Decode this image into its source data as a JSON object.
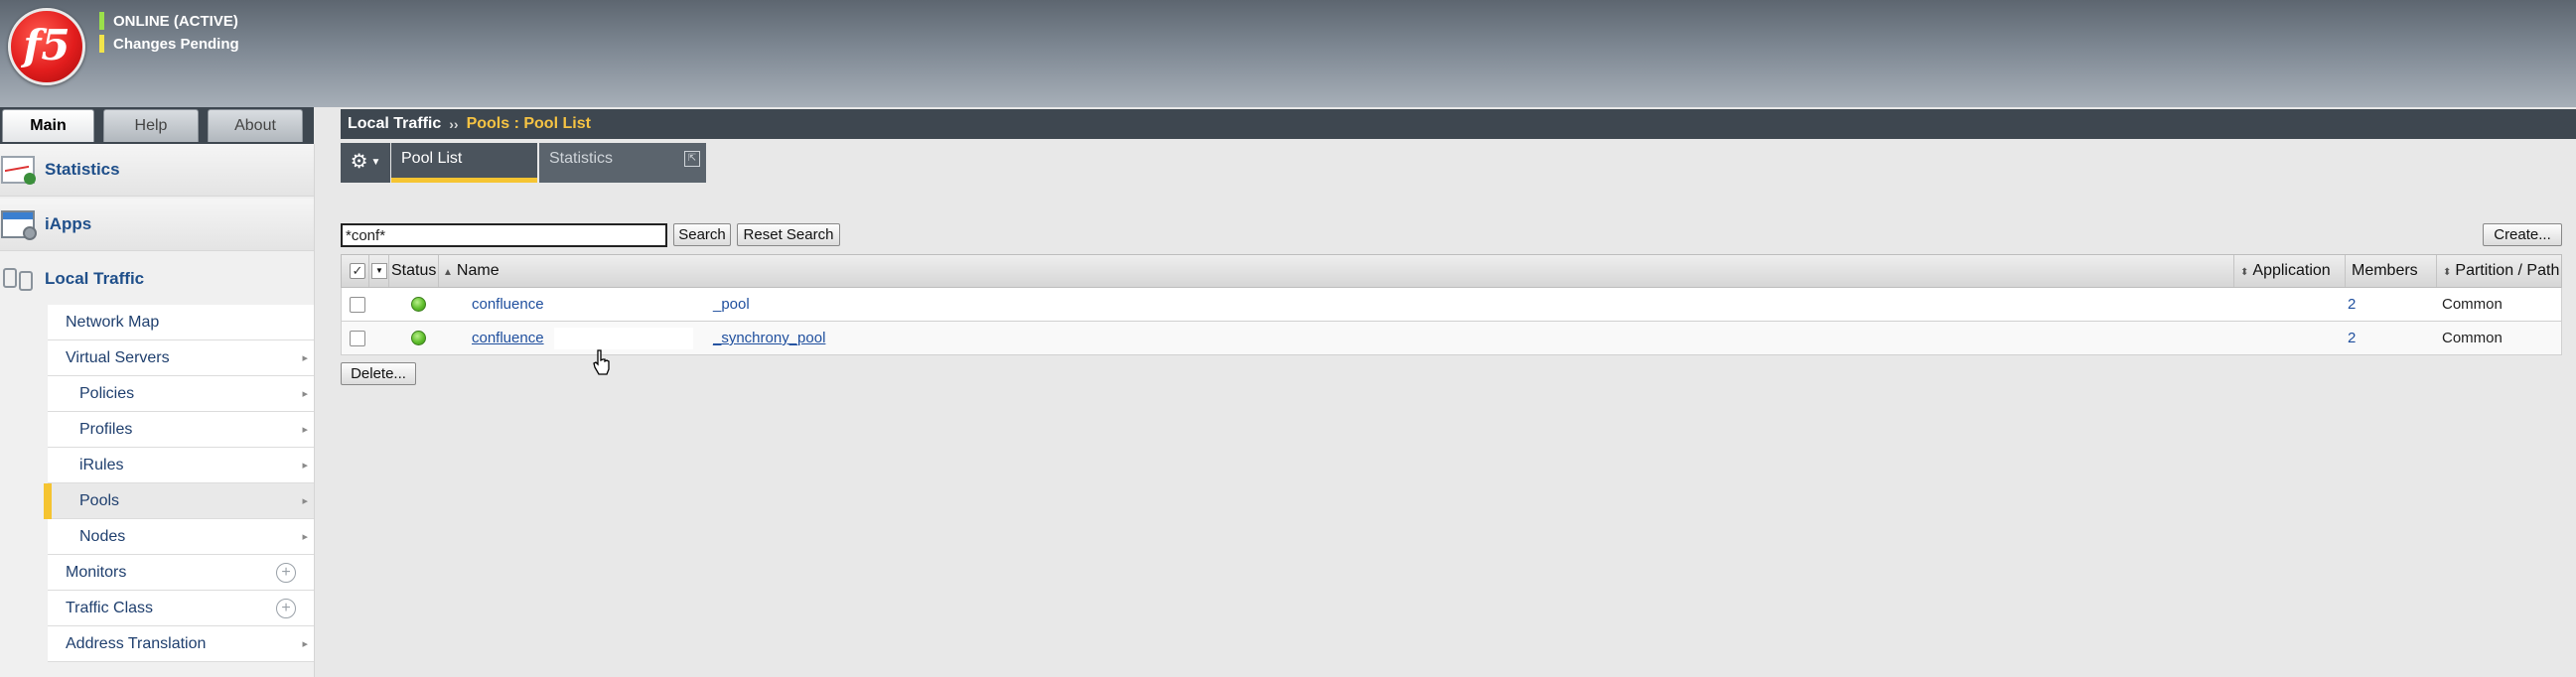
{
  "header": {
    "logo_text": "f5",
    "status_online": "ONLINE (ACTIVE)",
    "status_pending": "Changes Pending"
  },
  "left_tabs": [
    "Main",
    "Help",
    "About"
  ],
  "sidebar": {
    "sections": [
      {
        "label": "Statistics",
        "icon": "statistics-icon"
      },
      {
        "label": "iApps",
        "icon": "iapps-icon"
      },
      {
        "label": "Local Traffic",
        "icon": "local-traffic-icon"
      }
    ],
    "subitems": [
      {
        "label": "Network Map",
        "arrow": "",
        "plus": false
      },
      {
        "label": "Virtual Servers",
        "arrow": "▸",
        "plus": false
      },
      {
        "label": "Policies",
        "arrow": "▸",
        "plus": false
      },
      {
        "label": "Profiles",
        "arrow": "▸",
        "plus": false
      },
      {
        "label": "iRules",
        "arrow": "▸",
        "plus": false
      },
      {
        "label": "Pools",
        "arrow": "▸",
        "plus": false
      },
      {
        "label": "Nodes",
        "arrow": "▸",
        "plus": false
      },
      {
        "label": "Monitors",
        "arrow": "",
        "plus": true
      },
      {
        "label": "Traffic Class",
        "arrow": "",
        "plus": true
      },
      {
        "label": "Address Translation",
        "arrow": "▸",
        "plus": false
      }
    ],
    "plus_symbol": "+"
  },
  "breadcrumb": {
    "root": "Local Traffic",
    "separator": "››",
    "current": "Pools : Pool List"
  },
  "tabs": {
    "gear_symbol": "⚙",
    "dropdown_symbol": "▼",
    "pool_list": "Pool List",
    "statistics": "Statistics",
    "external_symbol": "⇱"
  },
  "search": {
    "value": "*conf*",
    "search_label": "Search",
    "reset_label": "Reset Search",
    "create_label": "Create..."
  },
  "table": {
    "columns": {
      "status": "Status",
      "name": "Name",
      "application": "Application",
      "members": "Members",
      "partition": "Partition / Path"
    },
    "sort_up": "▲",
    "sort_both": "⬍",
    "rows": [
      {
        "name_prefix": "confluence",
        "name_suffix": "_pool",
        "application": "",
        "members": "2",
        "partition": "Common",
        "status": "available"
      },
      {
        "name_prefix": "confluence",
        "name_suffix": "_synchrony_pool",
        "application": "",
        "members": "2",
        "partition": "Common",
        "status": "available"
      }
    ]
  },
  "delete_label": "Delete..."
}
